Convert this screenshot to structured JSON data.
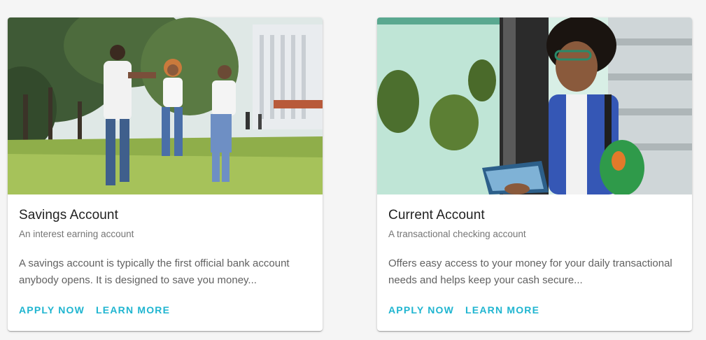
{
  "cards": [
    {
      "title": "Savings Account",
      "subtitle": "An interest earning account",
      "body": "A savings account is typically the first official bank account anybody opens. It is designed to save you money...",
      "apply_label": "APPLY NOW",
      "learn_label": "LEARN MORE"
    },
    {
      "title": "Current Account",
      "subtitle": "A transactional checking account",
      "body": "Offers easy access to your money for your daily transactional needs and helps keep your cash secure...",
      "apply_label": "APPLY NOW",
      "learn_label": "LEARN MORE"
    }
  ],
  "colors": {
    "accent": "#1fb5d0",
    "title": "#212121",
    "subtitle": "#757575",
    "body": "#616161",
    "background": "#f5f5f5"
  }
}
